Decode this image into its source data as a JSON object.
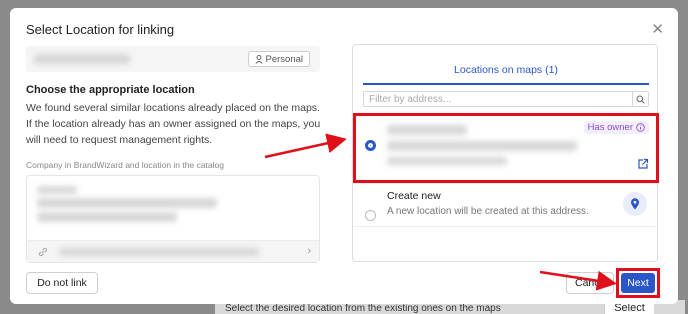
{
  "backdrop": {
    "hint": "Select the desired location from the existing ones on the maps",
    "select_label": "Select"
  },
  "dialog": {
    "title": "Select Location for linking",
    "close_glyph": "✕"
  },
  "left": {
    "badge": "Personal",
    "heading": "Choose the appropriate location",
    "description": "We found several similar locations already placed on the maps. If the location already has an owner assigned on the maps, you will need to request management rights.",
    "catalog_label": "Company in BrandWizard and location in the catalog",
    "chevron": "›"
  },
  "right": {
    "tab_label": "Locations on maps (1)",
    "filter_placeholder": "Filter by address...",
    "location1": {
      "badge": "Has owner",
      "selected": true
    },
    "location2": {
      "title": "Create new",
      "subtitle": "A new location will be created at this address."
    }
  },
  "footer": {
    "do_not_link": "Do not link",
    "cancel": "Canc",
    "next": "Next"
  },
  "colors": {
    "accent": "#2a56c8",
    "highlight": "#e0101b",
    "owner": "#8a4ed0"
  }
}
